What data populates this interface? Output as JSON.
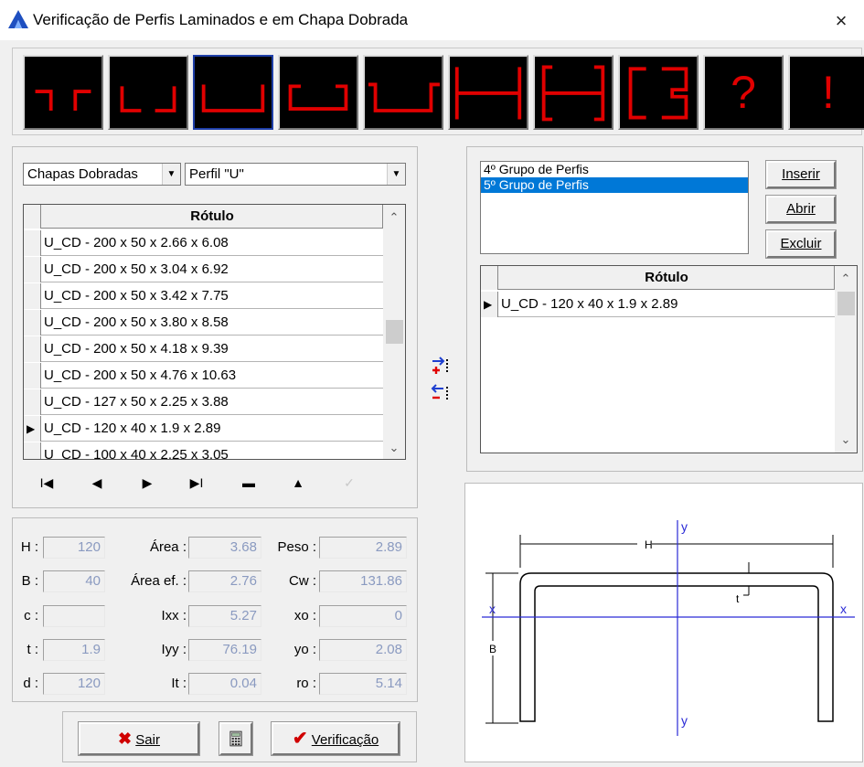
{
  "window": {
    "title": "Verificação de Perfis Laminados e em Chapa Dobrada",
    "close_symbol": "×"
  },
  "toolbar": {
    "buttons": [
      {
        "name": "double-angle-profile",
        "icon": "jl-shape-icon"
      },
      {
        "name": "double-c-profile",
        "icon": "lj-shape-icon"
      },
      {
        "name": "u-profile",
        "icon": "u-shape-icon",
        "selected": true
      },
      {
        "name": "lipped-u-profile",
        "icon": "lipped-u-shape-icon"
      },
      {
        "name": "u-flange-profile",
        "icon": "u-flange-shape-icon"
      },
      {
        "name": "i-profile",
        "icon": "i-shape-icon"
      },
      {
        "name": "double-lipped-i-profile",
        "icon": "lipped-i-shape-icon"
      },
      {
        "name": "box-profile",
        "icon": "box-shape-icon"
      },
      {
        "name": "help",
        "icon": "question-icon",
        "glyph": "?"
      },
      {
        "name": "alert",
        "icon": "exclamation-icon",
        "glyph": "!"
      }
    ]
  },
  "filters": {
    "type_combo": "Chapas Dobradas",
    "profile_combo": "Perfil  \"U\""
  },
  "catalog_grid": {
    "header": "Rótulo",
    "rows": [
      {
        "label": "U_CD - 200 x 50 x 2.66 x 6.08",
        "current": false
      },
      {
        "label": "U_CD - 200 x 50 x 3.04 x 6.92",
        "current": false
      },
      {
        "label": "U_CD - 200 x 50 x 3.42 x 7.75",
        "current": false
      },
      {
        "label": "U_CD - 200 x 50 x 3.80 x 8.58",
        "current": false
      },
      {
        "label": "U_CD - 200 x 50 x 4.18 x 9.39",
        "current": false
      },
      {
        "label": "U_CD - 200 x 50 x 4.76 x 10.63",
        "current": false
      },
      {
        "label": "U_CD - 127 x 50 x 2.25 x 3.88",
        "current": false
      },
      {
        "label": "U_CD - 120 x 40 x 1.9 x 2.89",
        "current": true
      },
      {
        "label": "U_CD - 100 x 40 x 2.25 x 3.05",
        "current": false
      }
    ]
  },
  "navigator": {
    "first": "I◀",
    "prior": "◀",
    "next": "▶",
    "last": "▶I",
    "delete": "▬",
    "edit": "▲",
    "post": "✓"
  },
  "properties": {
    "col1": [
      {
        "label": "H :",
        "value": "120"
      },
      {
        "label": "B :",
        "value": "40"
      },
      {
        "label": "c :",
        "value": ""
      },
      {
        "label": "t :",
        "value": "1.9"
      },
      {
        "label": "d :",
        "value": "120"
      }
    ],
    "col2": [
      {
        "label": "Área :",
        "value": "3.68"
      },
      {
        "label": "Área ef. :",
        "value": "2.76"
      },
      {
        "label": "Ixx :",
        "value": "5.27"
      },
      {
        "label": "Iyy :",
        "value": "76.19"
      },
      {
        "label": "It :",
        "value": "0.04"
      }
    ],
    "col3": [
      {
        "label": "Peso :",
        "value": "2.89"
      },
      {
        "label": "Cw :",
        "value": "131.86"
      },
      {
        "label": "xo :",
        "value": "0"
      },
      {
        "label": "yo :",
        "value": "2.08"
      },
      {
        "label": "ro :",
        "value": "5.14"
      }
    ]
  },
  "actions": {
    "exit_label": "Sair",
    "verify_label": "Verificação"
  },
  "groups": {
    "items": [
      {
        "label": "4º Grupo de Perfis",
        "selected": false
      },
      {
        "label": "5º Grupo de Perfis",
        "selected": true
      }
    ],
    "insert_label": "Inserir",
    "open_label": "Abrir",
    "delete_label": "Excluir"
  },
  "group_grid": {
    "header": "Rótulo",
    "rows": [
      {
        "label": "U_CD - 120 x 40 x 1.9 x 2.89",
        "current": true
      }
    ]
  },
  "drawing": {
    "dim_h": "H",
    "dim_b": "B",
    "dim_t": "t",
    "axis_x_left": "x",
    "axis_x_right": "x",
    "axis_y_top": "y",
    "axis_y_bottom": "y"
  },
  "colors": {
    "accent_red": "#e00000",
    "selection_blue": "#0078d7",
    "axis_blue": "#2a2ad6",
    "disabled_value": "#8a9ac0"
  }
}
